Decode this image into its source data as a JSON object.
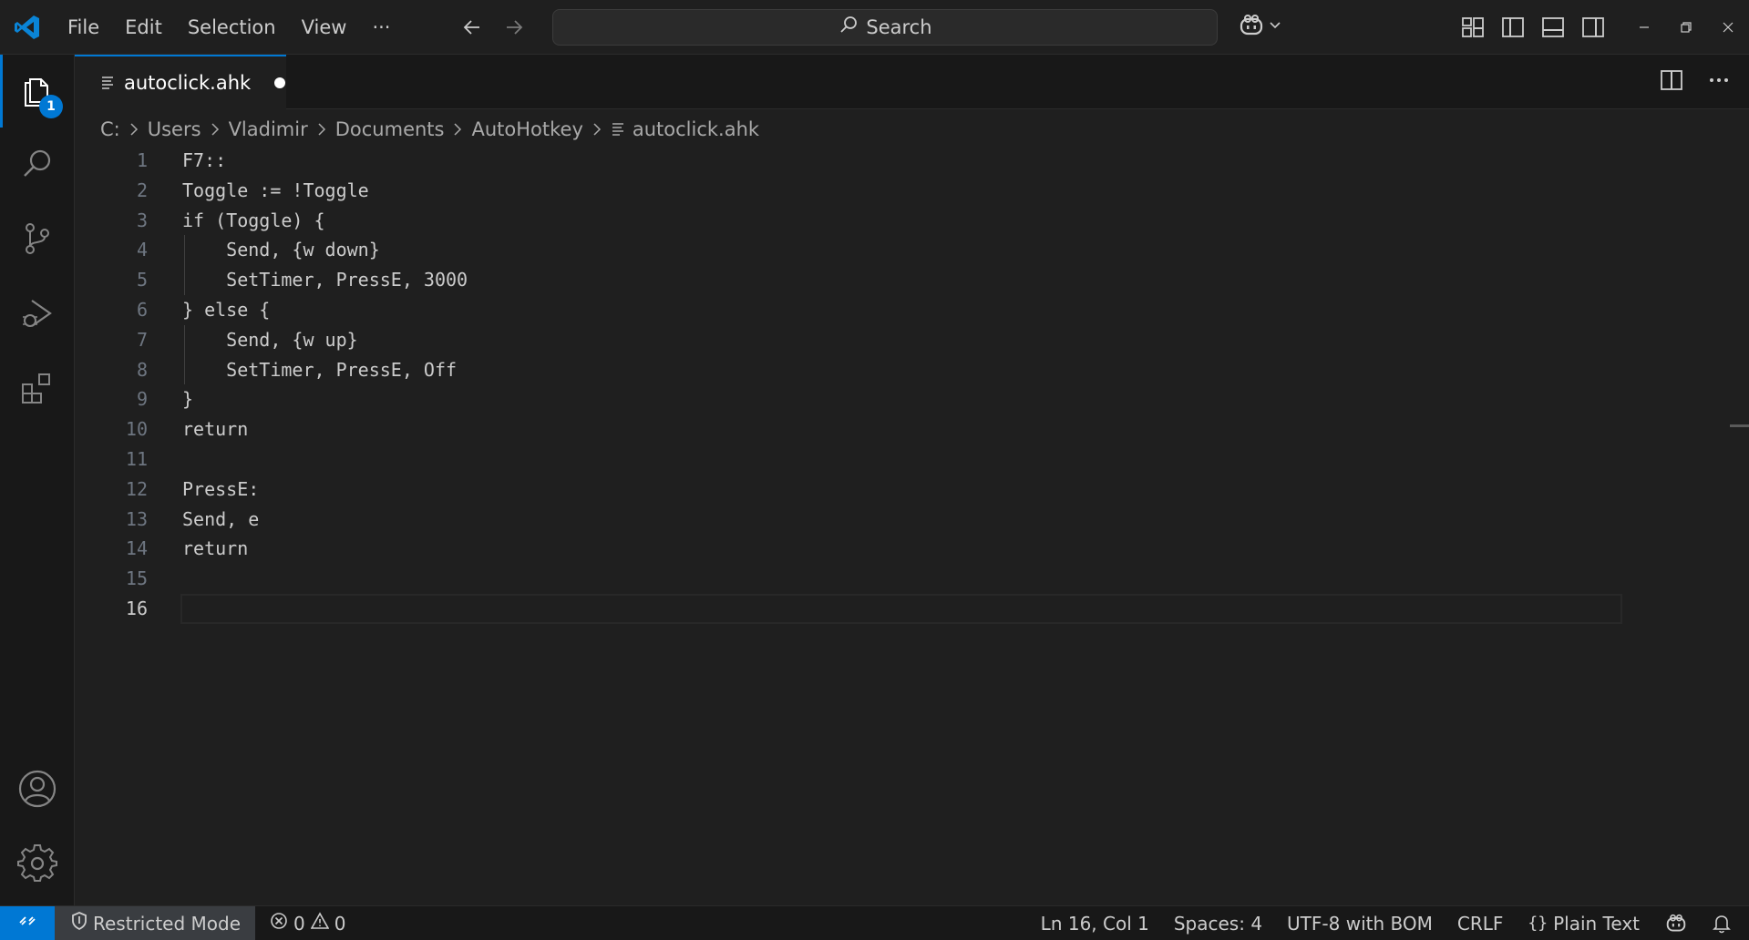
{
  "menu": {
    "items": [
      "File",
      "Edit",
      "Selection",
      "View",
      "···"
    ]
  },
  "search": {
    "label": "Search"
  },
  "activity_bar": {
    "explorer_badge": "1"
  },
  "tab": {
    "filename": "autoclick.ahk"
  },
  "breadcrumb": [
    "C:",
    "Users",
    "Vladimir",
    "Documents",
    "AutoHotkey",
    "autoclick.ahk"
  ],
  "editor": {
    "line_numbers": [
      "1",
      "2",
      "3",
      "4",
      "5",
      "6",
      "7",
      "8",
      "9",
      "10",
      "11",
      "12",
      "13",
      "14",
      "15",
      "16"
    ],
    "lines": [
      "F7::",
      "Toggle := !Toggle",
      "if (Toggle) {",
      "    Send, {w down}",
      "    SetTimer, PressE, 3000",
      "} else {",
      "    Send, {w up}",
      "    SetTimer, PressE, Off",
      "}",
      "return",
      "",
      "PressE:",
      "Send, e",
      "return",
      "",
      ""
    ],
    "current_line": 16
  },
  "statusbar": {
    "restricted": "Restricted Mode",
    "errors": "0",
    "warnings": "0",
    "position": "Ln 16, Col 1",
    "spaces": "Spaces: 4",
    "encoding": "UTF-8 with BOM",
    "eol": "CRLF",
    "language": "Plain Text"
  },
  "colors": {
    "accent": "#0078d4",
    "background": "#1f1f1f",
    "sidebar": "#181818"
  }
}
